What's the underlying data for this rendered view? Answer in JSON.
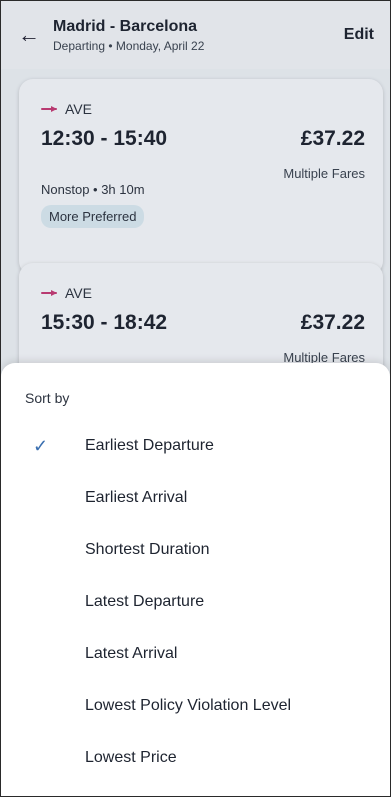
{
  "header": {
    "title": "Madrid - Barcelona",
    "subtitle": "Departing • Monday, April 22",
    "edit_label": "Edit"
  },
  "results": [
    {
      "operator": "AVE",
      "times": "12:30 - 15:40",
      "price": "£37.22",
      "fare_note": "Multiple Fares",
      "duration": "Nonstop • 3h 10m",
      "badge": "More Preferred"
    },
    {
      "operator": "AVE",
      "times": "15:30 - 18:42",
      "price": "£37.22",
      "fare_note": "Multiple Fares"
    }
  ],
  "sort_sheet": {
    "title": "Sort by",
    "options": [
      {
        "label": "Earliest Departure",
        "selected": true
      },
      {
        "label": "Earliest Arrival",
        "selected": false
      },
      {
        "label": "Shortest Duration",
        "selected": false
      },
      {
        "label": "Latest Departure",
        "selected": false
      },
      {
        "label": "Latest Arrival",
        "selected": false
      },
      {
        "label": "Lowest Policy Violation Level",
        "selected": false
      },
      {
        "label": "Lowest Price",
        "selected": false
      }
    ]
  },
  "colors": {
    "operator_brand": "#c23b74",
    "check_accent": "#3a6fb0",
    "badge_bg": "#d7e6ef"
  },
  "icons": {
    "back": "arrow-left-icon",
    "operator_logo": "train-line-icon",
    "selected": "checkmark-icon"
  }
}
